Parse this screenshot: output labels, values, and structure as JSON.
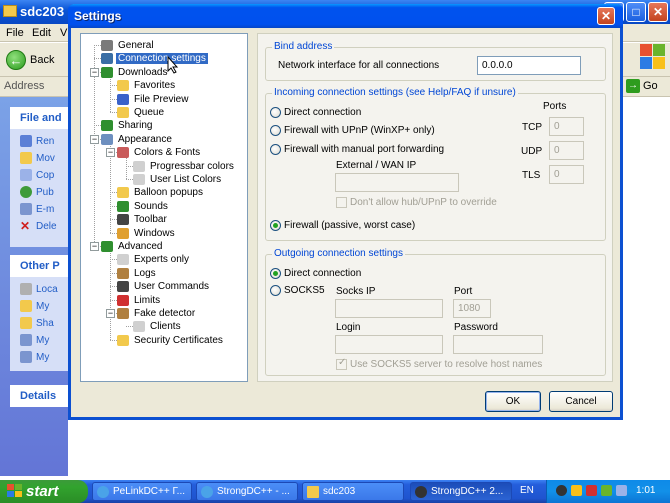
{
  "explorer": {
    "title": "sdc203",
    "menu": [
      "File",
      "Edit",
      "V"
    ],
    "back_label": "Back",
    "address_label": "Address",
    "go_label": "Go",
    "panels": [
      {
        "head": "File and",
        "links": [
          "Ren",
          "Mov",
          "Cop",
          "Pub",
          "E-m",
          "Dele"
        ]
      },
      {
        "head": "Other P",
        "links": [
          "Loca",
          "My",
          "Sha",
          "My",
          "My"
        ]
      },
      {
        "head": "Details",
        "links": []
      }
    ]
  },
  "dialog": {
    "title": "Settings",
    "tree": [
      {
        "label": "General",
        "icon": "gear-icon",
        "color": "#7a7a7a"
      },
      {
        "label": "Connection settings",
        "icon": "network-icon",
        "color": "#3a6ea5"
      },
      {
        "label": "Downloads",
        "icon": "download-icon",
        "color": "#2f8f2f"
      },
      {
        "label": "Favorites",
        "icon": "folder-icon",
        "color": "#f2c94c"
      },
      {
        "label": "File Preview",
        "icon": "preview-icon",
        "color": "#3a62c9"
      },
      {
        "label": "Queue",
        "icon": "queue-icon",
        "color": "#f2c94c"
      },
      {
        "label": "Sharing",
        "icon": "sharing-icon",
        "color": "#2f8f2f"
      },
      {
        "label": "Appearance",
        "icon": "appearance-icon",
        "color": "#6d8fbf"
      },
      {
        "label": "Colors & Fonts",
        "icon": "palette-icon",
        "color": "#c95b5b"
      },
      {
        "label": "Progressbar colors",
        "icon": "document-icon",
        "color": "#d0d0d0"
      },
      {
        "label": "User List Colors",
        "icon": "document-icon",
        "color": "#d0d0d0"
      },
      {
        "label": "Balloon popups",
        "icon": "folder-icon",
        "color": "#f2c94c"
      },
      {
        "label": "Sounds",
        "icon": "sound-icon",
        "color": "#2f8f2f"
      },
      {
        "label": "Toolbar",
        "icon": "toolbar-icon",
        "color": "#444444"
      },
      {
        "label": "Windows",
        "icon": "windows-icon",
        "color": "#e0a030"
      },
      {
        "label": "Advanced",
        "icon": "advanced-icon",
        "color": "#2f8f2f"
      },
      {
        "label": "Experts only",
        "icon": "document-icon",
        "color": "#d0d0d0"
      },
      {
        "label": "Logs",
        "icon": "logs-icon",
        "color": "#b08040"
      },
      {
        "label": "User Commands",
        "icon": "commands-icon",
        "color": "#444444"
      },
      {
        "label": "Limits",
        "icon": "limits-icon",
        "color": "#d03030"
      },
      {
        "label": "Fake detector",
        "icon": "detector-icon",
        "color": "#b08040"
      },
      {
        "label": "Clients",
        "icon": "clients-icon",
        "color": "#d0d0d0"
      },
      {
        "label": "Security Certificates",
        "icon": "certificate-icon",
        "color": "#f2c94c"
      }
    ],
    "bind": {
      "legend": "Bind address",
      "label": "Network interface for all connections",
      "value": "0.0.0.0"
    },
    "incoming": {
      "legend": "Incoming connection settings (see Help/FAQ if unsure)",
      "ports_label": "Ports",
      "direct": "Direct connection",
      "upnp": "Firewall with UPnP (WinXP+ only)",
      "manual": "Firewall with manual port forwarding",
      "passive": "Firewall (passive, worst case)",
      "external_label": "External / WAN IP",
      "external_value": "",
      "dont_allow": "Don't allow hub/UPnP to override",
      "tcp_label": "TCP",
      "udp_label": "UDP",
      "tls_label": "TLS",
      "tcp_value": "0",
      "udp_value": "0",
      "tls_value": "0",
      "selected": "passive"
    },
    "outgoing": {
      "legend": "Outgoing connection settings",
      "direct": "Direct connection",
      "socks": "SOCKS5",
      "socks_ip_label": "Socks IP",
      "port_label": "Port",
      "port_value": "1080",
      "login_label": "Login",
      "password_label": "Password",
      "resolve": "Use SOCKS5 server to resolve host names",
      "selected": "direct"
    },
    "ok_label": "OK",
    "cancel_label": "Cancel"
  },
  "taskbar": {
    "start_label": "start",
    "buttons": [
      "PeLinkDC++ Г...",
      "StrongDC++ - ...",
      "sdc203",
      "StrongDC++ 2..."
    ],
    "lang": "EN",
    "clock": "1:01"
  }
}
